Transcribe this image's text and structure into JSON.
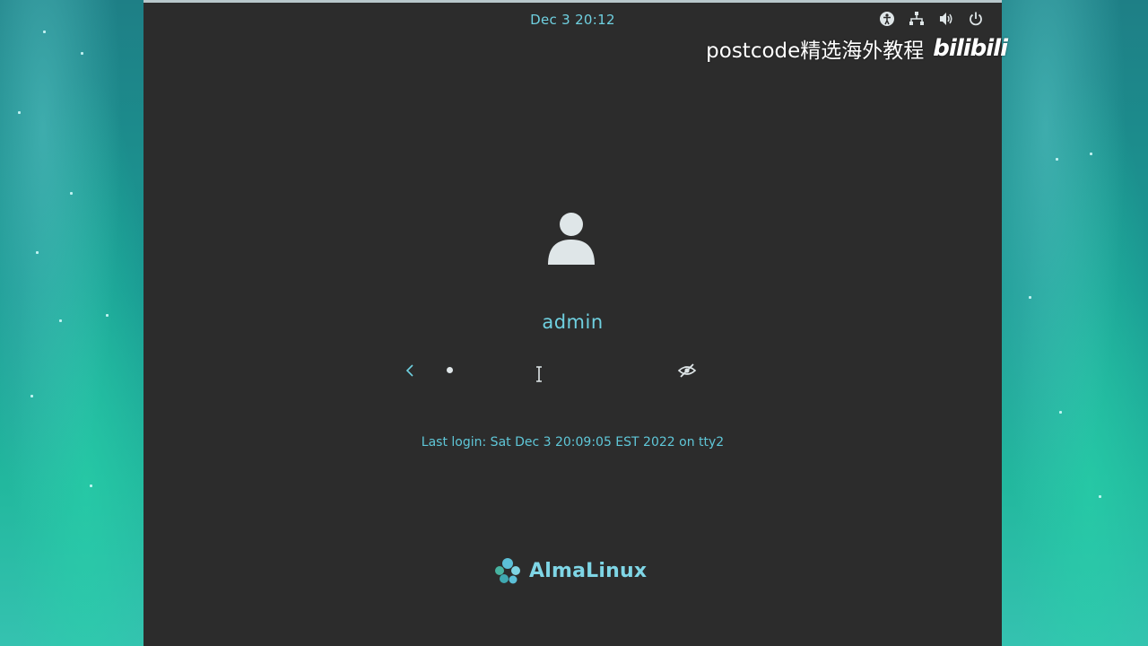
{
  "top_bar": {
    "clock": "Dec 3  20:12",
    "tray_icons": [
      "accessibility-icon",
      "network-icon",
      "volume-icon",
      "power-icon"
    ]
  },
  "watermark": {
    "text": "postcode精选海外教程",
    "logo": "bilibili"
  },
  "login": {
    "user_icon": "user-avatar-icon",
    "username": "admin",
    "password_masked": "•",
    "last_login": "Last login: Sat Dec  3 20:09:05 EST 2022 on tty2"
  },
  "brand": {
    "name": "AlmaLinux"
  },
  "colors": {
    "accent": "#6fd0e0",
    "panel_bg": "#2c2c2c",
    "desktop_teal": "#1eb89f"
  }
}
